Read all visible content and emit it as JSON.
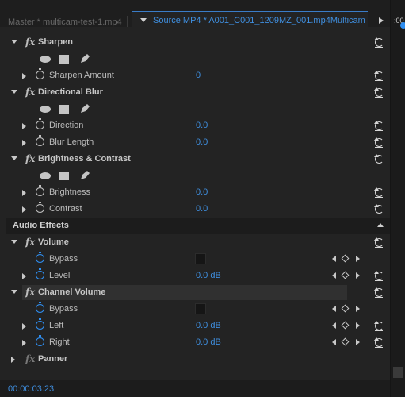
{
  "tabs": {
    "master": "Master * multicam-test-1.mp4",
    "source": "Source MP4 * A001_C001_1209MZ_001.mp4Multicam"
  },
  "timeline": {
    "timecode": ":00"
  },
  "effects": {
    "sharpen": {
      "name": "Sharpen",
      "params": [
        {
          "name": "Sharpen Amount",
          "value": "0"
        }
      ]
    },
    "directional_blur": {
      "name": "Directional Blur",
      "params": [
        {
          "name": "Direction",
          "value": "0.0"
        },
        {
          "name": "Blur Length",
          "value": "0.0"
        }
      ]
    },
    "brightness_contrast": {
      "name": "Brightness & Contrast",
      "params": [
        {
          "name": "Brightness",
          "value": "0.0"
        },
        {
          "name": "Contrast",
          "value": "0.0"
        }
      ]
    }
  },
  "audio": {
    "section_label": "Audio Effects",
    "volume": {
      "name": "Volume",
      "bypass": "Bypass",
      "level": {
        "name": "Level",
        "value": "0.0 dB"
      }
    },
    "channel_volume": {
      "name": "Channel Volume",
      "bypass": "Bypass",
      "left": {
        "name": "Left",
        "value": "0.0 dB"
      },
      "right": {
        "name": "Right",
        "value": "0.0 dB"
      }
    },
    "panner": {
      "name": "Panner"
    }
  },
  "status": {
    "timecode": "00:00:03:23"
  },
  "colors": {
    "accent": "#3f8fe0",
    "background": "#232323"
  }
}
